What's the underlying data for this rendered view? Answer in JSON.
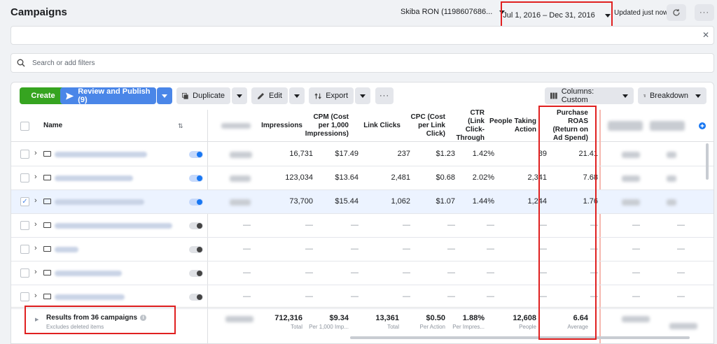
{
  "header": {
    "title": "Campaigns",
    "account": "Skiba RON (1198607686...",
    "date_range": "Jul 1, 2016 – Dec 31, 2016",
    "updated": "Updated just now"
  },
  "search": {
    "placeholder": "Search or add filters"
  },
  "toolbar": {
    "create": "Create",
    "review_publish": "Review and Publish (9)",
    "duplicate": "Duplicate",
    "edit": "Edit",
    "export": "Export",
    "more": "···",
    "columns_prefix": "Columns:",
    "columns_value": "Custom",
    "breakdown": "Breakdown"
  },
  "columns": {
    "name": "Name",
    "impressions": "Impressions",
    "cpm": "CPM (Cost per 1,000 Impressions)",
    "link_clicks": "Link Clicks",
    "cpc": "CPC (Cost per Link Click)",
    "ctr": "CTR (Link Click-Through",
    "people_taking_action": "People Taking Action",
    "roas": "Purchase ROAS (Return on Ad Spend)"
  },
  "rows": [
    {
      "checked": false,
      "on": true,
      "impressions": "16,731",
      "cpm": "$17.49",
      "link_clicks": "237",
      "cpc": "$1.23",
      "ctr": "1.42%",
      "people": "89",
      "roas": "21.41"
    },
    {
      "checked": false,
      "on": true,
      "impressions": "123,034",
      "cpm": "$13.64",
      "link_clicks": "2,481",
      "cpc": "$0.68",
      "ctr": "2.02%",
      "people": "2,341",
      "roas": "7.68"
    },
    {
      "checked": true,
      "on": true,
      "impressions": "73,700",
      "cpm": "$15.44",
      "link_clicks": "1,062",
      "cpc": "$1.07",
      "ctr": "1.44%",
      "people": "1,244",
      "roas": "1.76"
    },
    {
      "checked": false,
      "on": false,
      "impressions": "—",
      "cpm": "—",
      "link_clicks": "—",
      "cpc": "—",
      "ctr": "—",
      "people": "—",
      "roas": "—"
    },
    {
      "checked": false,
      "on": false,
      "impressions": "—",
      "cpm": "—",
      "link_clicks": "—",
      "cpc": "—",
      "ctr": "—",
      "people": "—",
      "roas": "—"
    },
    {
      "checked": false,
      "on": false,
      "impressions": "—",
      "cpm": "—",
      "link_clicks": "—",
      "cpc": "—",
      "ctr": "—",
      "people": "—",
      "roas": "—"
    },
    {
      "checked": false,
      "on": false,
      "impressions": "—",
      "cpm": "—",
      "link_clicks": "—",
      "cpc": "—",
      "ctr": "—",
      "people": "—",
      "roas": "—"
    }
  ],
  "footer": {
    "results": "Results from 36 campaigns",
    "excludes": "Excludes deleted items",
    "impressions": "712,316",
    "impressions_sub": "Total",
    "cpm": "$9.34",
    "cpm_sub": "Per 1,000 Imp...",
    "link_clicks": "13,361",
    "link_clicks_sub": "Total",
    "cpc": "$0.50",
    "cpc_sub": "Per Action",
    "ctr": "1.88%",
    "ctr_sub": "Per Impres...",
    "people": "12,608",
    "people_sub": "People",
    "roas": "6.64",
    "roas_sub": "Average"
  },
  "colors": {
    "create": "#36a420",
    "primary": "#4a86e8",
    "highlight": "#e02020"
  }
}
